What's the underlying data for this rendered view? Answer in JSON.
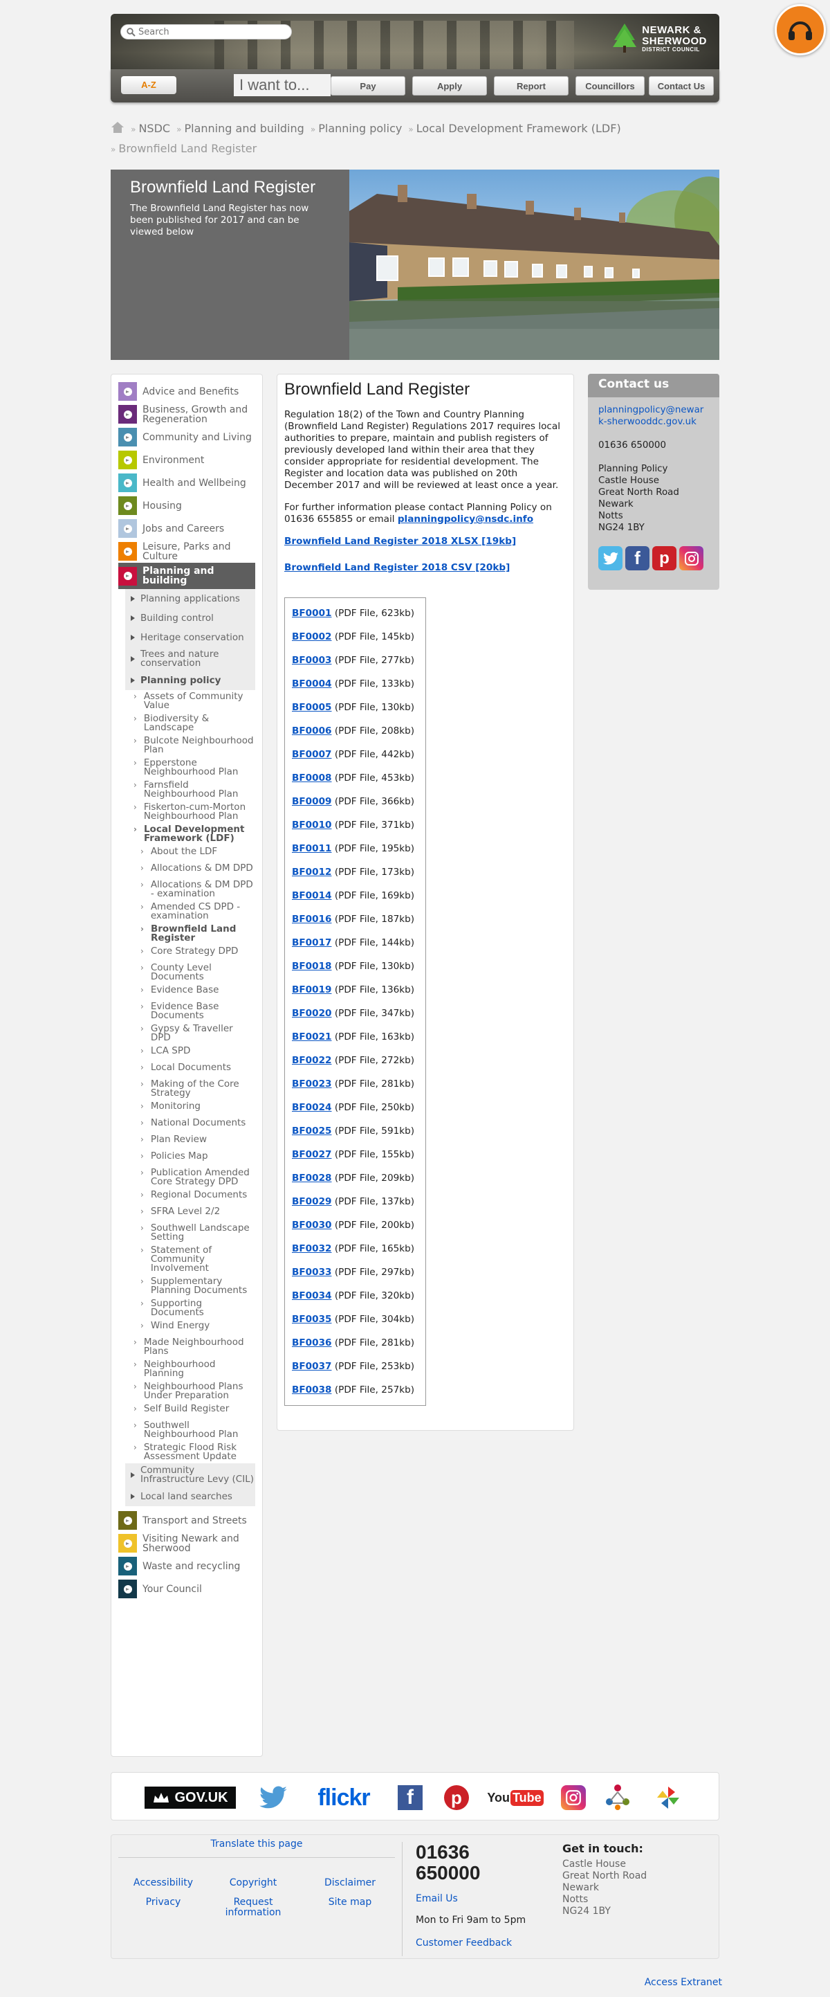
{
  "header": {
    "search_placeholder": "Search",
    "logo": {
      "line1": "NEWARK &",
      "line2": "SHERWOOD",
      "line3": "DISTRICT COUNCIL"
    },
    "az_label": "A-Z",
    "iwant_label": "I want to...",
    "nav": [
      "Pay",
      "Apply",
      "Report",
      "Councillors",
      "Contact Us"
    ]
  },
  "breadcrumb": [
    "NSDC",
    "Planning and building",
    "Planning policy",
    "Local Development Framework (LDF)",
    "Brownfield Land Register"
  ],
  "hero": {
    "title": "Brownfield Land Register",
    "text": "The Brownfield Land Register has now been published for 2017 and can be viewed below"
  },
  "sidebar": {
    "top_before": [
      {
        "label": "Advice and Benefits",
        "color": "#a07ec4"
      },
      {
        "label": "Business, Growth and Regeneration",
        "color": "#6a2b7a"
      },
      {
        "label": "Community and Living",
        "color": "#4a8fb0"
      },
      {
        "label": "Environment",
        "color": "#b7c800"
      },
      {
        "label": "Health and Wellbeing",
        "color": "#4ab8c8"
      },
      {
        "label": "Housing",
        "color": "#6e8a1f"
      },
      {
        "label": "Jobs and Careers",
        "color": "#b0c6de"
      },
      {
        "label": "Leisure, Parks and Culture",
        "color": "#ee7f00"
      }
    ],
    "active": {
      "label": "Planning and building",
      "color": "#c8103e"
    },
    "sub1_before": [
      "Planning applications",
      "Building control",
      "Heritage conservation",
      "Trees and nature conservation"
    ],
    "sub1_selected": "Planning policy",
    "sub2_before": [
      "Assets of Community Value",
      "Biodiversity & Landscape",
      "Bulcote Neighbourhood Plan",
      "Epperstone Neighbourhood Plan",
      "Farnsfield Neighbourhood Plan",
      "Fiskerton-cum-Morton Neighbourhood Plan"
    ],
    "sub2_selected": "Local Development Framework (LDF)",
    "sub3": [
      "About the LDF",
      "Allocations & DM DPD",
      "Allocations & DM DPD - examination",
      "Amended CS DPD - examination",
      "Brownfield Land Register",
      "Core Strategy DPD",
      "County Level Documents",
      "Evidence Base",
      "Evidence Base Documents",
      "Gypsy & Traveller DPD",
      "LCA SPD",
      "Local Documents",
      "Making of the Core Strategy",
      "Monitoring",
      "National Documents",
      "Plan Review",
      "Policies Map",
      "Publication Amended Core Strategy DPD",
      "Regional Documents",
      "SFRA Level 2/2",
      "Southwell Landscape Setting",
      "Statement of Community Involvement",
      "Supplementary Planning Documents",
      "Supporting Documents",
      "Wind Energy"
    ],
    "sub3_selected": "Brownfield Land Register",
    "sub2_after": [
      "Made Neighbourhood Plans",
      "Neighbourhood Planning",
      "Neighbourhood Plans Under Preparation",
      "Self Build Register",
      "Southwell Neighbourhood Plan",
      "Strategic Flood Risk Assessment Update"
    ],
    "sub1_after": [
      "Community Infrastructure Levy (CIL)",
      "Local land searches"
    ],
    "top_after": [
      {
        "label": "Transport and Streets",
        "color": "#6e6a18"
      },
      {
        "label": "Visiting Newark and Sherwood",
        "color": "#efc22a"
      },
      {
        "label": "Waste and recycling",
        "color": "#19617a"
      },
      {
        "label": "Your Council",
        "color": "#13394a"
      }
    ]
  },
  "main": {
    "title": "Brownfield Land Register",
    "para1": "Regulation 18(2) of the Town and Country Planning (Brownfield Land Register) Regulations 2017 requires local authorities to prepare, maintain and publish registers of previously developed land within their area that they consider appropriate for residential development.  The Register and location data was published on 20th December 2017 and will be reviewed at least once a year.",
    "para2_text": "For further information please contact  Planning Policy on 01636 655855 or email ",
    "para2_email": "planningpolicy@nsdc.info",
    "xlsx_link": "Brownfield Land Register 2018 XLSX [19kb]",
    "csv_link": "Brownfield Land Register 2018 CSV [20kb]",
    "files": [
      {
        "name": "BF0001",
        "meta": "(PDF File, 623kb)"
      },
      {
        "name": "BF0002",
        "meta": "(PDF File, 145kb)"
      },
      {
        "name": "BF0003",
        "meta": "(PDF File, 277kb)"
      },
      {
        "name": "BF0004",
        "meta": "(PDF File, 133kb)"
      },
      {
        "name": "BF0005",
        "meta": "(PDF File, 130kb)"
      },
      {
        "name": "BF0006",
        "meta": "(PDF File, 208kb)"
      },
      {
        "name": "BF0007",
        "meta": "(PDF File, 442kb)"
      },
      {
        "name": "BF0008",
        "meta": "(PDF File, 453kb)"
      },
      {
        "name": "BF0009",
        "meta": "(PDF File, 366kb)"
      },
      {
        "name": "BF0010",
        "meta": "(PDF File, 371kb)"
      },
      {
        "name": "BF0011",
        "meta": "(PDF File, 195kb)"
      },
      {
        "name": "BF0012",
        "meta": "(PDF File, 173kb)"
      },
      {
        "name": "BF0014",
        "meta": "(PDF File, 169kb)"
      },
      {
        "name": "BF0016",
        "meta": "(PDF File, 187kb)"
      },
      {
        "name": "BF0017",
        "meta": "(PDF File, 144kb)"
      },
      {
        "name": "BF0018",
        "meta": "(PDF File, 130kb)"
      },
      {
        "name": "BF0019",
        "meta": "(PDF File, 136kb)"
      },
      {
        "name": "BF0020",
        "meta": "(PDF File, 347kb)"
      },
      {
        "name": "BF0021",
        "meta": "(PDF File, 163kb)"
      },
      {
        "name": "BF0022",
        "meta": "(PDF File, 272kb)"
      },
      {
        "name": "BF0023",
        "meta": "(PDF File, 281kb)"
      },
      {
        "name": "BF0024",
        "meta": "(PDF File, 250kb)"
      },
      {
        "name": "BF0025",
        "meta": "(PDF File, 591kb)"
      },
      {
        "name": "BF0027",
        "meta": "(PDF File, 155kb)"
      },
      {
        "name": "BF0028",
        "meta": "(PDF File, 209kb)"
      },
      {
        "name": "BF0029",
        "meta": "(PDF File, 137kb)"
      },
      {
        "name": "BF0030",
        "meta": "(PDF File, 200kb)"
      },
      {
        "name": "BF0032",
        "meta": "(PDF File, 165kb)"
      },
      {
        "name": "BF0033",
        "meta": "(PDF File, 297kb)"
      },
      {
        "name": "BF0034",
        "meta": "(PDF File, 320kb)"
      },
      {
        "name": "BF0035",
        "meta": "(PDF File, 304kb)"
      },
      {
        "name": "BF0036",
        "meta": "(PDF File, 281kb)"
      },
      {
        "name": "BF0037",
        "meta": "(PDF File, 253kb)"
      },
      {
        "name": "BF0038",
        "meta": "(PDF File, 257kb)"
      }
    ]
  },
  "contact": {
    "title": "Contact us",
    "email": "planningpolicy@newark-sherwooddc.gov.uk",
    "phone": "01636 650000",
    "address": [
      "Planning Policy",
      "Castle House",
      "Great North Road",
      "Newark",
      "Notts",
      "NG24 1BY"
    ]
  },
  "logos": {
    "govuk": "GOV.UK",
    "flickr": "flickr",
    "youtube_you": "You",
    "youtube_tube": "Tube"
  },
  "footer": {
    "translate": "Translate this page",
    "links": [
      "Accessibility",
      "Copyright",
      "Disclaimer",
      "Privacy",
      "Request information",
      "Site map"
    ],
    "phone": "01636 650000",
    "email_us": "Email Us",
    "hours": "Mon to Fri 9am to 5pm",
    "feedback": "Customer Feedback",
    "git_title": "Get in touch:",
    "address": [
      "Castle House",
      "Great North Road",
      "Newark",
      "Notts",
      "NG24 1BY"
    ]
  },
  "access_extranet": "Access Extranet"
}
